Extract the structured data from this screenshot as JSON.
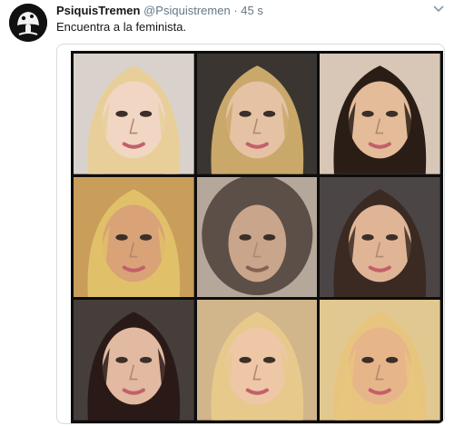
{
  "tweet": {
    "display_name": "PsiquisTremen",
    "handle": "@Psiquistremen",
    "separator": "·",
    "time": "45 s",
    "text": "Encuentra a la feminista."
  },
  "icons": {
    "avatar": "mushroom-logo-icon",
    "more": "chevron-down-icon"
  },
  "media": {
    "cells": [
      {
        "hair": "#e8cf9a",
        "skin": "#f1d6c4",
        "bg": "#d9d2cc"
      },
      {
        "hair": "#c9a86a",
        "skin": "#e6c2a4",
        "bg": "#3a3530"
      },
      {
        "hair": "#2a1d16",
        "skin": "#e4bc99",
        "bg": "#d8c7b6"
      },
      {
        "hair": "#e1c06a",
        "skin": "#d9a277",
        "bg": "#c99d5a"
      },
      {
        "hair": "#5b4f47",
        "skin": "#c8a58b",
        "bg": "#b6a79b"
      },
      {
        "hair": "#3b2a22",
        "skin": "#e0b596",
        "bg": "#4b4546"
      },
      {
        "hair": "#2a1a17",
        "skin": "#e2b9a1",
        "bg": "#463e3b"
      },
      {
        "hair": "#e7c98c",
        "skin": "#edc7a6",
        "bg": "#d1b58b"
      },
      {
        "hair": "#e8c57e",
        "skin": "#e7b58a",
        "bg": "#e1c890"
      }
    ]
  }
}
